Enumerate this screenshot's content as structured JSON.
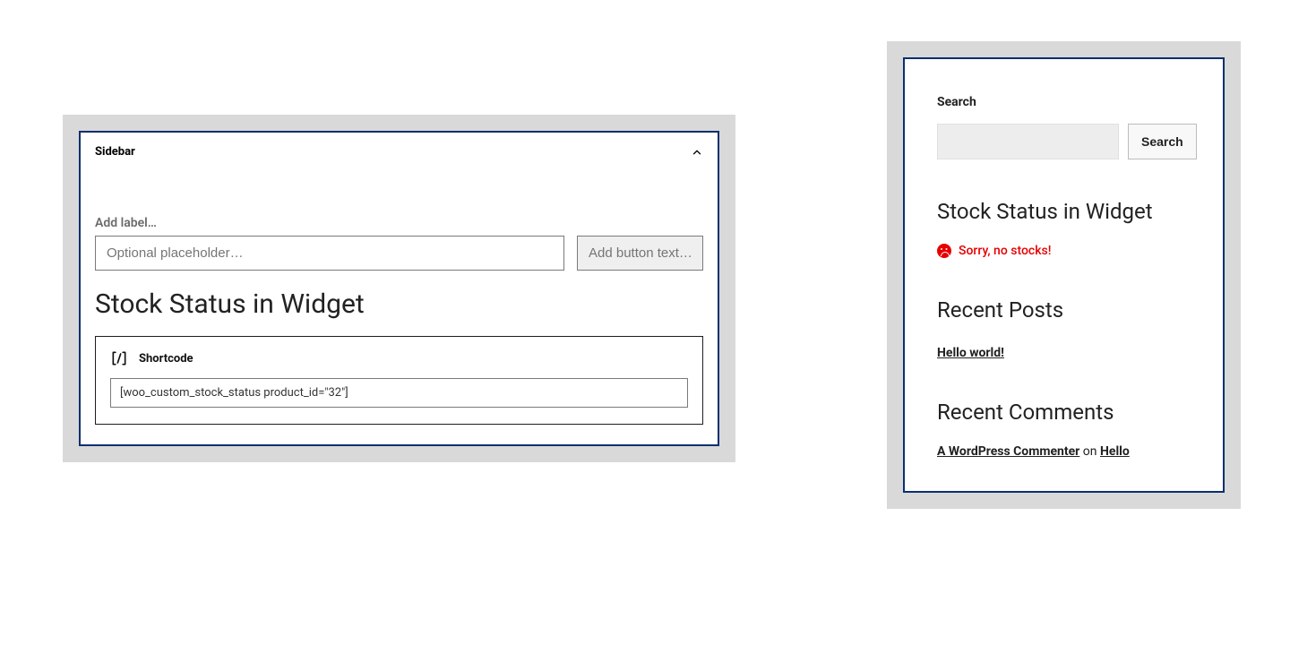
{
  "editor": {
    "panel_title": "Sidebar",
    "add_label_placeholder": "Add label…",
    "optional_placeholder": "Optional placeholder…",
    "add_button_placeholder": "Add button text…",
    "widget_heading": "Stock Status in Widget",
    "shortcode": {
      "label": "Shortcode",
      "value": "[woo_custom_stock_status product_id=\"32\"]"
    }
  },
  "preview": {
    "search": {
      "title": "Search",
      "button": "Search"
    },
    "stock_widget": {
      "heading": "Stock Status in Widget",
      "status_text": "Sorry, no stocks!"
    },
    "recent_posts": {
      "heading": "Recent Posts",
      "items": [
        "Hello world!"
      ]
    },
    "recent_comments": {
      "heading": "Recent Comments",
      "items": [
        {
          "author": "A WordPress Commenter",
          "on": "on",
          "post": "Hello"
        }
      ]
    }
  }
}
